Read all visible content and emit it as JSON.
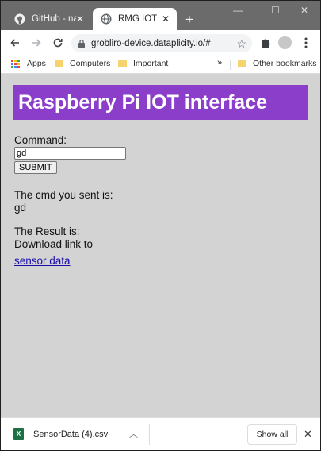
{
  "browser": {
    "tabs": [
      {
        "title": "GitHub - nan",
        "icon": "github-icon",
        "active": false
      },
      {
        "title": "RMG IOT",
        "icon": "globe-icon",
        "active": true
      }
    ],
    "new_tab_glyph": "+",
    "window_controls": {
      "minimize": "—",
      "maximize": "☐",
      "close": "✕"
    },
    "url": "grobliro-device.dataplicity.io/#",
    "bookmarks": [
      {
        "label": "Apps",
        "icon": "apps-grid-icon"
      },
      {
        "label": "Computers",
        "icon": "folder-icon"
      },
      {
        "label": "Important",
        "icon": "folder-icon"
      }
    ],
    "bookmarks_overflow": "»",
    "other_bookmarks": "Other bookmarks"
  },
  "page": {
    "banner_title": "Raspberry Pi IOT interface",
    "command_label": "Command:",
    "command_value": "gd",
    "submit_label": "SUBMIT",
    "sent_label": "The cmd you sent is:",
    "sent_value": "gd",
    "result_label": "The Result is:",
    "result_text": "Download link to",
    "result_link": "sensor data"
  },
  "downloads": {
    "file_name": "SensorData (4).csv",
    "file_icon": "excel-file-icon",
    "show_all_label": "Show all"
  },
  "colors": {
    "banner_bg": "#8b3ec9",
    "page_bg": "#d3d3d3",
    "tabstrip_bg": "#6b6b6b",
    "link": "#1a0dab"
  }
}
